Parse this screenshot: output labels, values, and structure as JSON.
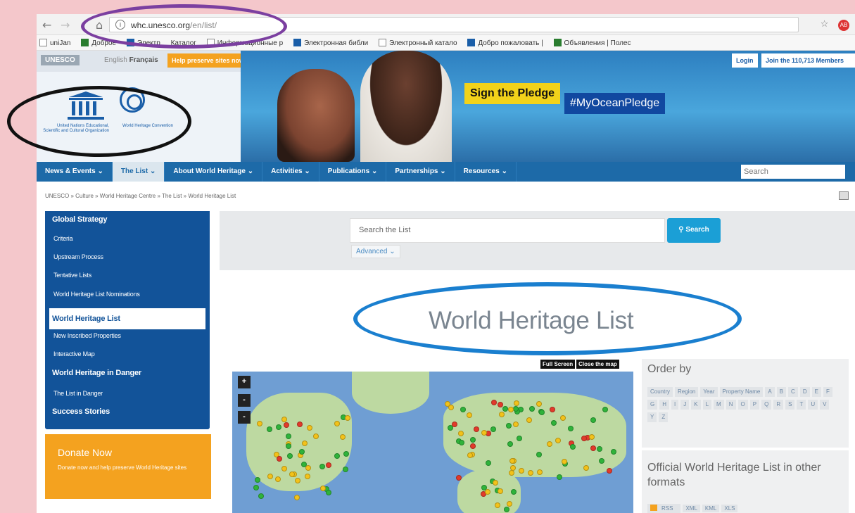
{
  "browser": {
    "url_host": "whc.unesco.org",
    "url_path": "/en/list/",
    "bookmarks": [
      "uniJan",
      "Доброе",
      "Электр",
      "Каталог",
      "Информационные р",
      "Электронная библи",
      "Электронный катало",
      "Добро пожаловать |",
      "Объявления | Полес"
    ]
  },
  "header": {
    "unesco_tab": "UNESCO",
    "lang_en": "English",
    "lang_fr": "Français",
    "help_label": "Help preserve sites now!",
    "org_name": "United Nations Educational, Scientific and Cultural Organization",
    "whc_name": "World Heritage Convention",
    "pledge_label": "Sign the Pledge",
    "hashtag": "#MyOceanPledge",
    "login_label": "Login",
    "join_label": "Join the 110,713 Members"
  },
  "nav": {
    "items": [
      "News & Events ⌄",
      "The List ⌄",
      "About World Heritage ⌄",
      "Activities ⌄",
      "Publications ⌄",
      "Partnerships ⌄",
      "Resources ⌄"
    ],
    "search_placeholder": "Search"
  },
  "breadcrumb": "UNESCO » Culture » World Heritage Centre » The List » World Heritage List",
  "sidebar": {
    "items": [
      {
        "label": "Global Strategy"
      },
      {
        "label": "Criteria"
      },
      {
        "label": "Upstream Process"
      },
      {
        "label": "Tentative Lists"
      },
      {
        "label": "World Heritage List Nominations"
      },
      {
        "label": "World Heritage List"
      },
      {
        "label": "New Inscribed Properties"
      },
      {
        "label": "Interactive Map"
      },
      {
        "label": "World Heritage in Danger"
      },
      {
        "label": "The List in Danger"
      },
      {
        "label": "Success Stories"
      }
    ]
  },
  "donate": {
    "title": "Donate Now",
    "desc": "Donate now and help preserve World Heritage sites"
  },
  "search": {
    "placeholder": "Search the List",
    "button": "Search",
    "advanced": "Advanced ⌄"
  },
  "page_title": "World Heritage List",
  "map": {
    "fullscreen": "Full Screen",
    "close": "Close the map",
    "zoom_in": "+",
    "zoom_out": "-",
    "reset": "-"
  },
  "order_by": {
    "title": "Order by",
    "options": [
      "Country",
      "Region",
      "Year",
      "Property Name",
      "A",
      "B",
      "C",
      "D",
      "E",
      "F",
      "G",
      "H",
      "I",
      "J",
      "K",
      "L",
      "M",
      "N",
      "O",
      "P",
      "Q",
      "R",
      "S",
      "T",
      "U",
      "V",
      "Y",
      "Z"
    ]
  },
  "formats": {
    "title": "Official World Heritage List in other formats",
    "items": [
      "RSS",
      "XML",
      "KML",
      "XLS"
    ]
  }
}
